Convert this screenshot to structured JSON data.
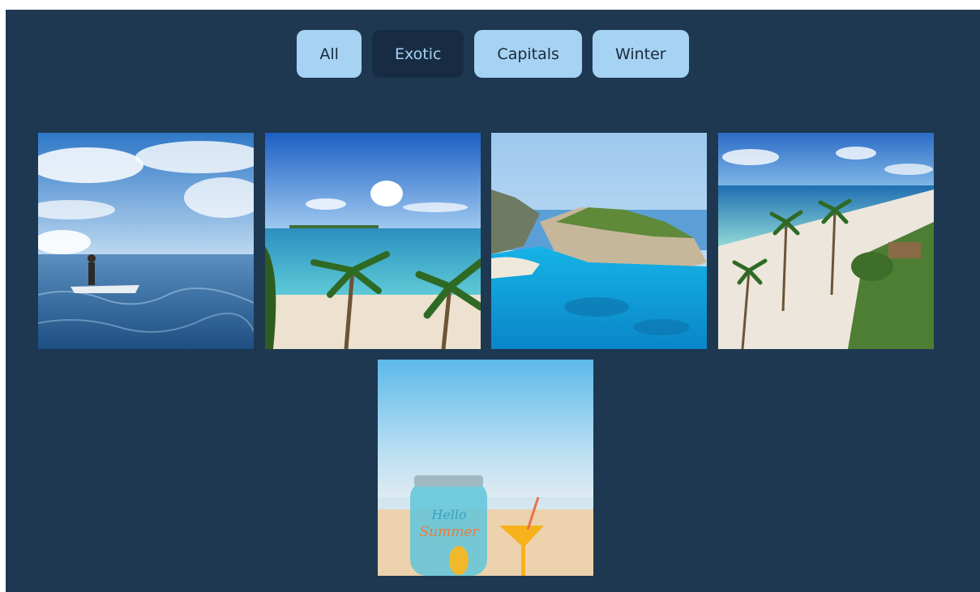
{
  "filters": [
    {
      "label": "All",
      "active": false
    },
    {
      "label": "Exotic",
      "active": true
    },
    {
      "label": "Capitals",
      "active": false
    },
    {
      "label": "Winter",
      "active": false
    }
  ],
  "gallery": {
    "photos": [
      {
        "subject": "jet-ski on open sea"
      },
      {
        "subject": "tropical beach with palm trees"
      },
      {
        "subject": "turquoise cove with cliffs"
      },
      {
        "subject": "resort beach with palms aerial view"
      },
      {
        "subject": "hello summer jar and cocktail on beach",
        "jar_text_line1": "Hello",
        "jar_text_line2": "Summer"
      }
    ]
  },
  "colors": {
    "page_background": "#1e3852",
    "button_background": "#a6d2f3",
    "button_active_background": "#172c42"
  }
}
